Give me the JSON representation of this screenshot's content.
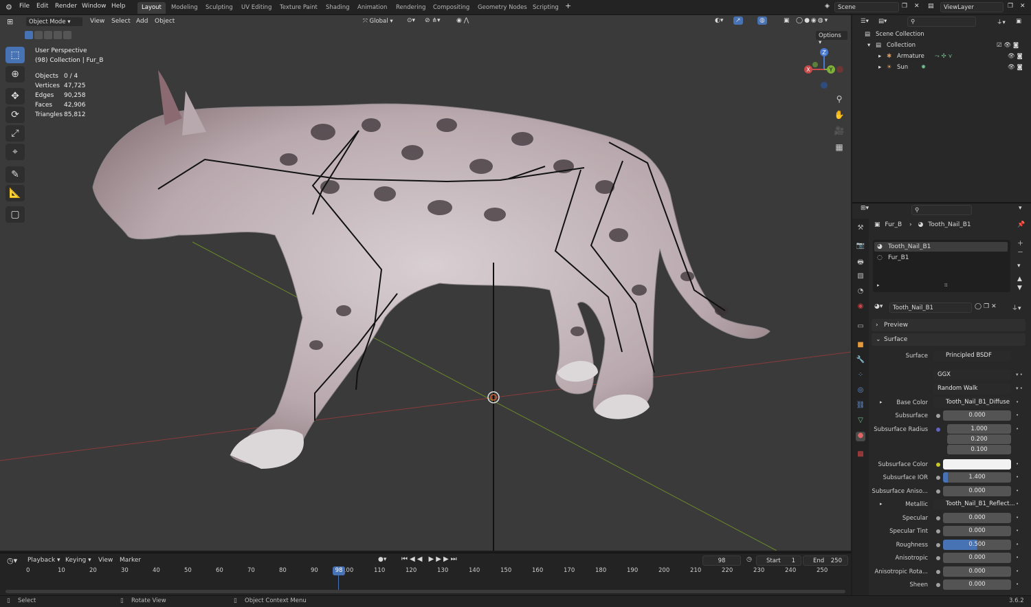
{
  "app": {
    "version": "3.6.2"
  },
  "menubar": {
    "items": [
      "File",
      "Edit",
      "Render",
      "Window",
      "Help"
    ],
    "workspaces": [
      "Layout",
      "Modeling",
      "Sculpting",
      "UV Editing",
      "Texture Paint",
      "Shading",
      "Animation",
      "Rendering",
      "Compositing",
      "Geometry Nodes",
      "Scripting"
    ],
    "active_workspace": "Layout",
    "add_tab": "+",
    "scene": "Scene",
    "view_layer": "ViewLayer"
  },
  "viewport_header": {
    "mode": "Object Mode",
    "menus": [
      "View",
      "Select",
      "Add",
      "Object"
    ],
    "transform": "Global",
    "options": "Options"
  },
  "viewport_overlay": {
    "perspective": "User Perspective",
    "collection": "(98) Collection | Fur_B",
    "stats": [
      {
        "label": "Objects",
        "value": "0 / 4"
      },
      {
        "label": "Vertices",
        "value": "47,725"
      },
      {
        "label": "Edges",
        "value": "90,258"
      },
      {
        "label": "Faces",
        "value": "42,906"
      },
      {
        "label": "Triangles",
        "value": "85,812"
      }
    ]
  },
  "gizmo": {
    "z": "Z",
    "y": "Y",
    "x": "X"
  },
  "outliner": {
    "root": "Scene Collection",
    "collection": "Collection",
    "items": [
      "Armature",
      "Sun"
    ]
  },
  "properties": {
    "breadcrumb": {
      "object": "Fur_B",
      "material": "Tooth_Nail_B1"
    },
    "slots": [
      "Tooth_Nail_B1",
      "Fur_B1"
    ],
    "material_name": "Tooth_Nail_B1",
    "sections": {
      "preview": "Preview",
      "surface": "Surface"
    },
    "surface_label": "Surface",
    "surface_shader": "Principled BSDF",
    "distribution": "GGX",
    "subsurface_method": "Random Walk",
    "rows": [
      {
        "label": "Base Color",
        "value": "Tooth_Nail_B1_Diffuse",
        "kind": "link",
        "socket": "#c7c729"
      },
      {
        "label": "Subsurface",
        "value": "0.000",
        "kind": "num",
        "socket": "#a1a1a1"
      },
      {
        "label": "Subsurface Radius",
        "values": [
          "1.000",
          "0.200",
          "0.100"
        ],
        "kind": "vec",
        "socket": "#6363c7"
      },
      {
        "label": "Subsurface Color",
        "value": "",
        "kind": "color",
        "socket": "#c7c729"
      },
      {
        "label": "Subsurface IOR",
        "value": "1.400",
        "kind": "num",
        "socket": "#a1a1a1",
        "fill": 0.07
      },
      {
        "label": "Subsurface Aniso...",
        "value": "0.000",
        "kind": "num",
        "socket": "#a1a1a1"
      },
      {
        "label": "Metallic",
        "value": "Tooth_Nail_B1_Reflect...",
        "kind": "link",
        "socket": "#a1a1a1"
      },
      {
        "label": "Specular",
        "value": "0.000",
        "kind": "num",
        "socket": "#a1a1a1"
      },
      {
        "label": "Specular Tint",
        "value": "0.000",
        "kind": "num",
        "socket": "#a1a1a1"
      },
      {
        "label": "Roughness",
        "value": "0.500",
        "kind": "num",
        "socket": "#a1a1a1",
        "fill": 0.5
      },
      {
        "label": "Anisotropic",
        "value": "0.000",
        "kind": "num",
        "socket": "#a1a1a1"
      },
      {
        "label": "Anisotropic Rota...",
        "value": "0.000",
        "kind": "num",
        "socket": "#a1a1a1"
      },
      {
        "label": "Sheen",
        "value": "0.000",
        "kind": "num",
        "socket": "#a1a1a1"
      }
    ]
  },
  "timeline": {
    "menus": [
      "Playback",
      "Keying",
      "View",
      "Marker"
    ],
    "current_frame": "98",
    "start_label": "Start",
    "start": "1",
    "end_label": "End",
    "end": "250",
    "ticks": [
      "0",
      "10",
      "20",
      "30",
      "40",
      "50",
      "60",
      "70",
      "80",
      "90",
      "100",
      "110",
      "120",
      "130",
      "140",
      "150",
      "160",
      "170",
      "180",
      "190",
      "200",
      "210",
      "220",
      "230",
      "240",
      "250"
    ]
  },
  "statusbar": {
    "select": "Select",
    "rotate": "Rotate View",
    "context": "Object Context Menu"
  },
  "colors": {
    "accent": "#4772b3",
    "header": "#232323",
    "panel": "#282828",
    "viewport": "#3a3a3a"
  }
}
